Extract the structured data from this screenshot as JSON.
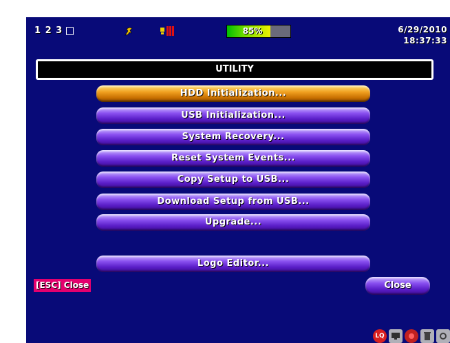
{
  "status": {
    "channels": "1 2 3",
    "hdd_text": "85%",
    "hdd_percent": 85,
    "date": "6/29/2010",
    "time": "18:37:33"
  },
  "title": "UTILITY",
  "menu": [
    {
      "label": "HDD Initialization...",
      "selected": true
    },
    {
      "label": "USB Initialization...",
      "selected": false
    },
    {
      "label": "System Recovery...",
      "selected": false
    },
    {
      "label": "Reset System Events...",
      "selected": false
    },
    {
      "label": "Copy Setup to USB...",
      "selected": false
    },
    {
      "label": "Download Setup from USB...",
      "selected": false
    },
    {
      "label": "Upgrade...",
      "selected": false
    },
    {
      "label": "Logo Editor...",
      "selected": false
    }
  ],
  "footer": {
    "esc_label": "[ESC] Close",
    "close_label": "Close"
  },
  "tray": {
    "lq_label": "LQ",
    "icons": [
      "lq-icon",
      "monitor-icon",
      "record-icon",
      "trash-icon",
      "settings-icon"
    ]
  },
  "colors": {
    "background": "#080a78",
    "selected": "#f0a020",
    "button": "#6a2ee0",
    "esc_highlight": "#e4006e"
  }
}
